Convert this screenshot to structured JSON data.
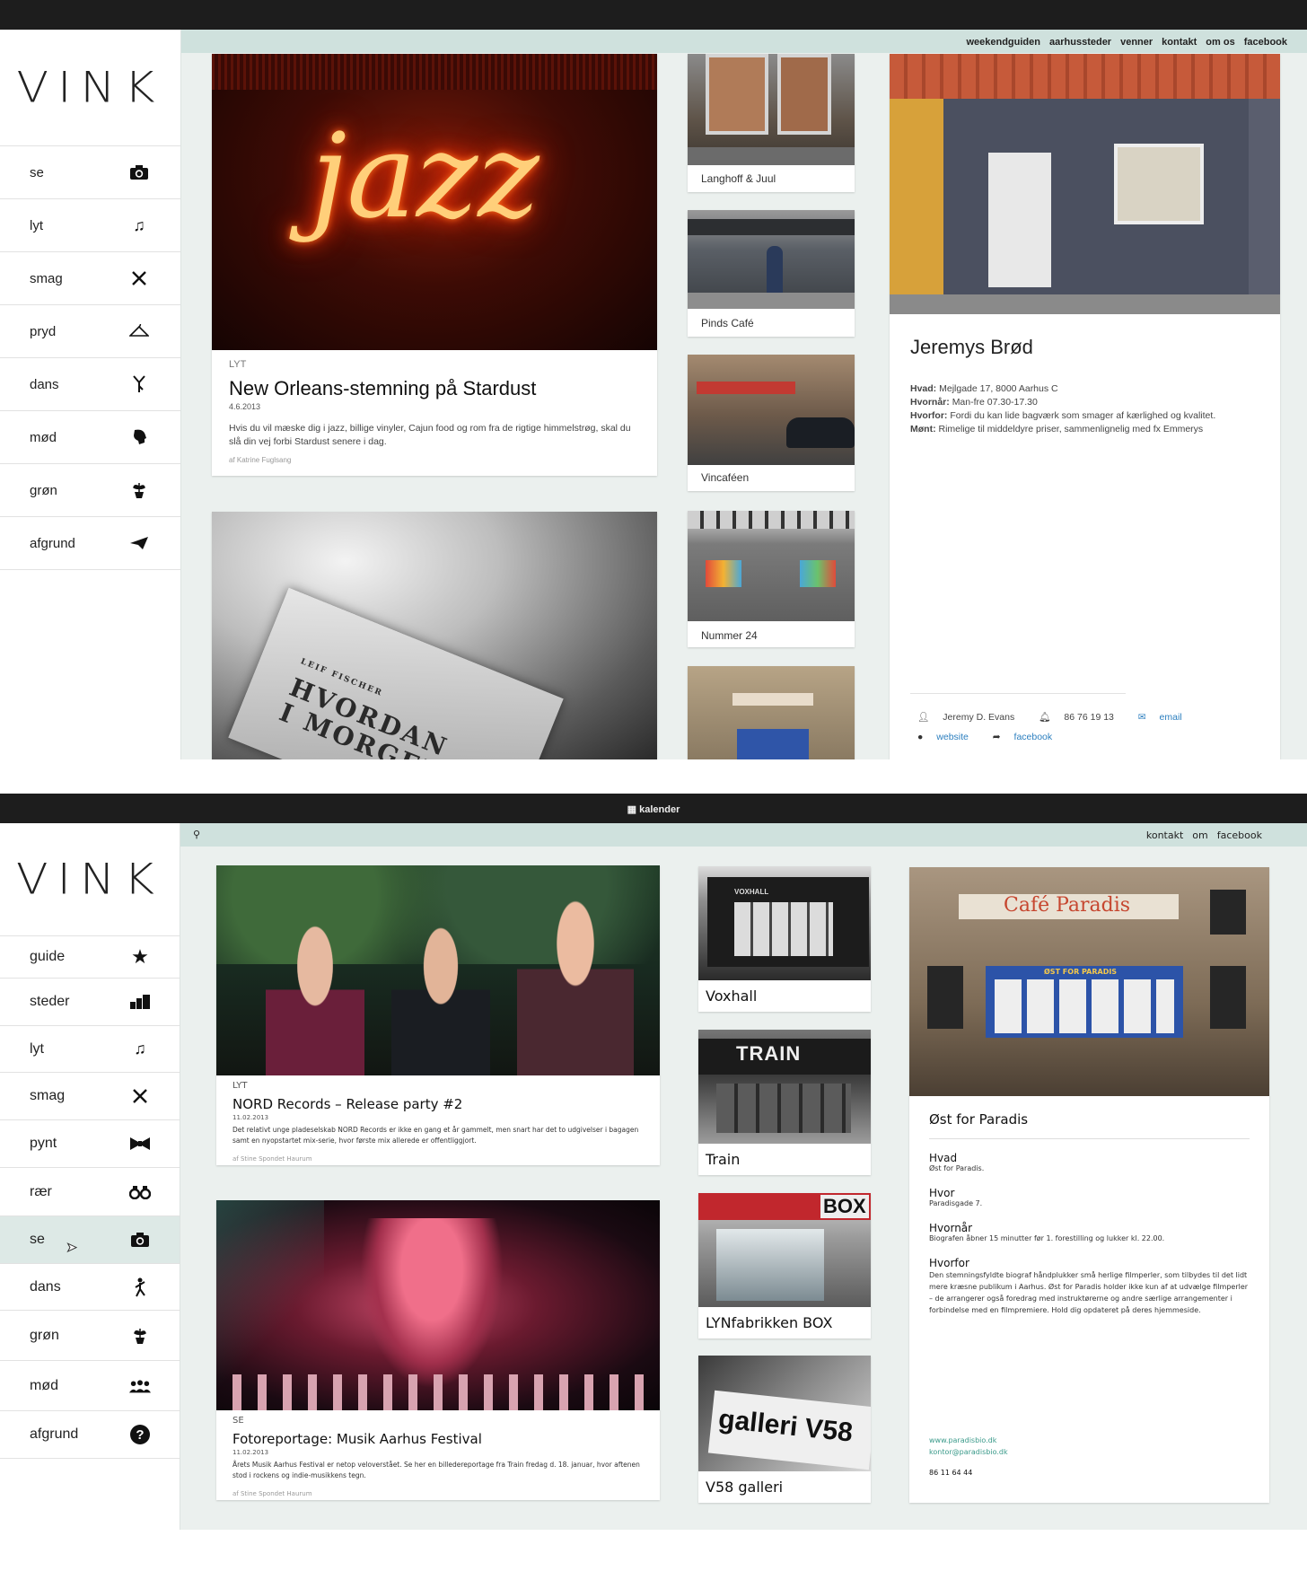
{
  "screen1": {
    "brand": "VINK",
    "nav": [
      {
        "label": "se",
        "icon": "camera-icon"
      },
      {
        "label": "lyt",
        "icon": "music-note-icon"
      },
      {
        "label": "smag",
        "icon": "cutlery-icon"
      },
      {
        "label": "pryd",
        "icon": "hanger-icon"
      },
      {
        "label": "dans",
        "icon": "dancer-icon"
      },
      {
        "label": "mød",
        "icon": "face-icon"
      },
      {
        "label": "grøn",
        "icon": "plant-icon"
      },
      {
        "label": "afgrund",
        "icon": "paper-plane-icon"
      }
    ],
    "top_links": [
      "weekendguiden",
      "aarhussteder",
      "venner",
      "kontakt",
      "om os",
      "facebook"
    ],
    "feature": {
      "category": "LYT",
      "title": "New Orleans-stemning på Stardust",
      "date": "4.6.2013",
      "excerpt": "Hvis du vil mæske dig i jazz, billige vinyler, Cajun food og rom fra de rigtige himmelstrøg, skal du slå din vej forbi Stardust senere i dag.",
      "author": "af Katrine Fuglsang",
      "neon_text": "jazz"
    },
    "book": {
      "line1": "HVORDAN",
      "line2": "I MORGEN?",
      "small": "LEIF FISCHER"
    },
    "thumbs": [
      "Langhoff & Juul",
      "Pinds Café",
      "Vincaféen",
      "Nummer 24",
      ""
    ],
    "detail": {
      "name": "Jeremys Brød",
      "hvad_label": "Hvad:",
      "hvad": "Mejlgade 17, 8000 Aarhus C",
      "hvornaar_label": "Hvornår:",
      "hvornaar": "Man-fre 07.30-17.30",
      "hvorfor_label": "Hvorfor:",
      "hvorfor": "Fordi du kan lide bagværk som smager af kærlighed og kvalitet.",
      "moent_label": "Mønt:",
      "moent": "Rimelige til middeldyre priser, sammenlignelig med fx Emmerys",
      "person": "Jeremy D. Evans",
      "phone": "86 76 19 13",
      "email": "email",
      "website": "website",
      "facebook": "facebook"
    }
  },
  "screen2": {
    "brand": "VINK",
    "calendar": "kalender",
    "top_links": [
      "kontakt",
      "om",
      "facebook"
    ],
    "nav": [
      {
        "label": "guide",
        "icon": "star-icon"
      },
      {
        "label": "steder",
        "icon": "buildings-icon"
      },
      {
        "label": "lyt",
        "icon": "music-note-icon"
      },
      {
        "label": "smag",
        "icon": "cutlery-icon"
      },
      {
        "label": "pynt",
        "icon": "bowtie-icon"
      },
      {
        "label": "rær",
        "icon": "binoculars-icon"
      },
      {
        "label": "se",
        "icon": "camera-icon"
      },
      {
        "label": "dans",
        "icon": "dancer-icon"
      },
      {
        "label": "grøn",
        "icon": "plant-icon"
      },
      {
        "label": "mød",
        "icon": "people-icon"
      },
      {
        "label": "afgrund",
        "icon": "question-icon"
      }
    ],
    "article1": {
      "category": "LYT",
      "title": "NORD Records – Release party #2",
      "date": "11.02.2013",
      "excerpt": "Det relativt unge pladeselskab NORD Records er ikke en gang et år gammelt, men snart har det to udgivelser i bagagen samt en nyopstartet mix-serie, hvor første mix allerede er offentliggjort.",
      "author": "af Stine Spondet Haurum"
    },
    "article2": {
      "category": "SE",
      "title": "Fotoreportage: Musik Aarhus Festival",
      "date": "11.02.2013",
      "excerpt": "Årets Musik Aarhus Festival er netop veloverstået.  Se her en billedereportage fra Train fredag d. 18. januar, hvor aftenen stod i rockens og indie-musikkens tegn.",
      "author": "af Stine Spondet Haurum"
    },
    "thumbs": [
      "Voxhall",
      "Train",
      "LYNfabrikken BOX",
      "V58 galleri"
    ],
    "thumb_signs": [
      "VOXHALL",
      "TRAIN",
      "BOX",
      "galleri V58"
    ],
    "detail": {
      "sign": "Café Paradis",
      "banner": "ØST FOR PARADIS",
      "name": "Øst for Paradis",
      "hvad_label": "Hvad",
      "hvad": "Øst for Paradis.",
      "hvor_label": "Hvor",
      "hvor": "Paradisgade 7.",
      "hvornaar_label": "Hvornår",
      "hvornaar": "Biografen åbner 15 minutter før 1. forestilling og lukker kl. 22.00.",
      "hvorfor_label": "Hvorfor",
      "hvorfor": "Den stemningsfyldte biograf håndplukker små herlige filmperler, som tilbydes til det lidt mere kræsne publikum i Aarhus. Øst for Paradis holder ikke kun af at udvælge filmperler – de arrangerer også foredrag med instruktørerne og andre særlige arrangementer i forbindelse med en filmpremiere. Hold dig opdateret på deres hjemmeside.",
      "web": "www.paradisbio.dk",
      "mail": "kontor@paradisbio.dk",
      "phone": "86 11 64 44"
    }
  }
}
